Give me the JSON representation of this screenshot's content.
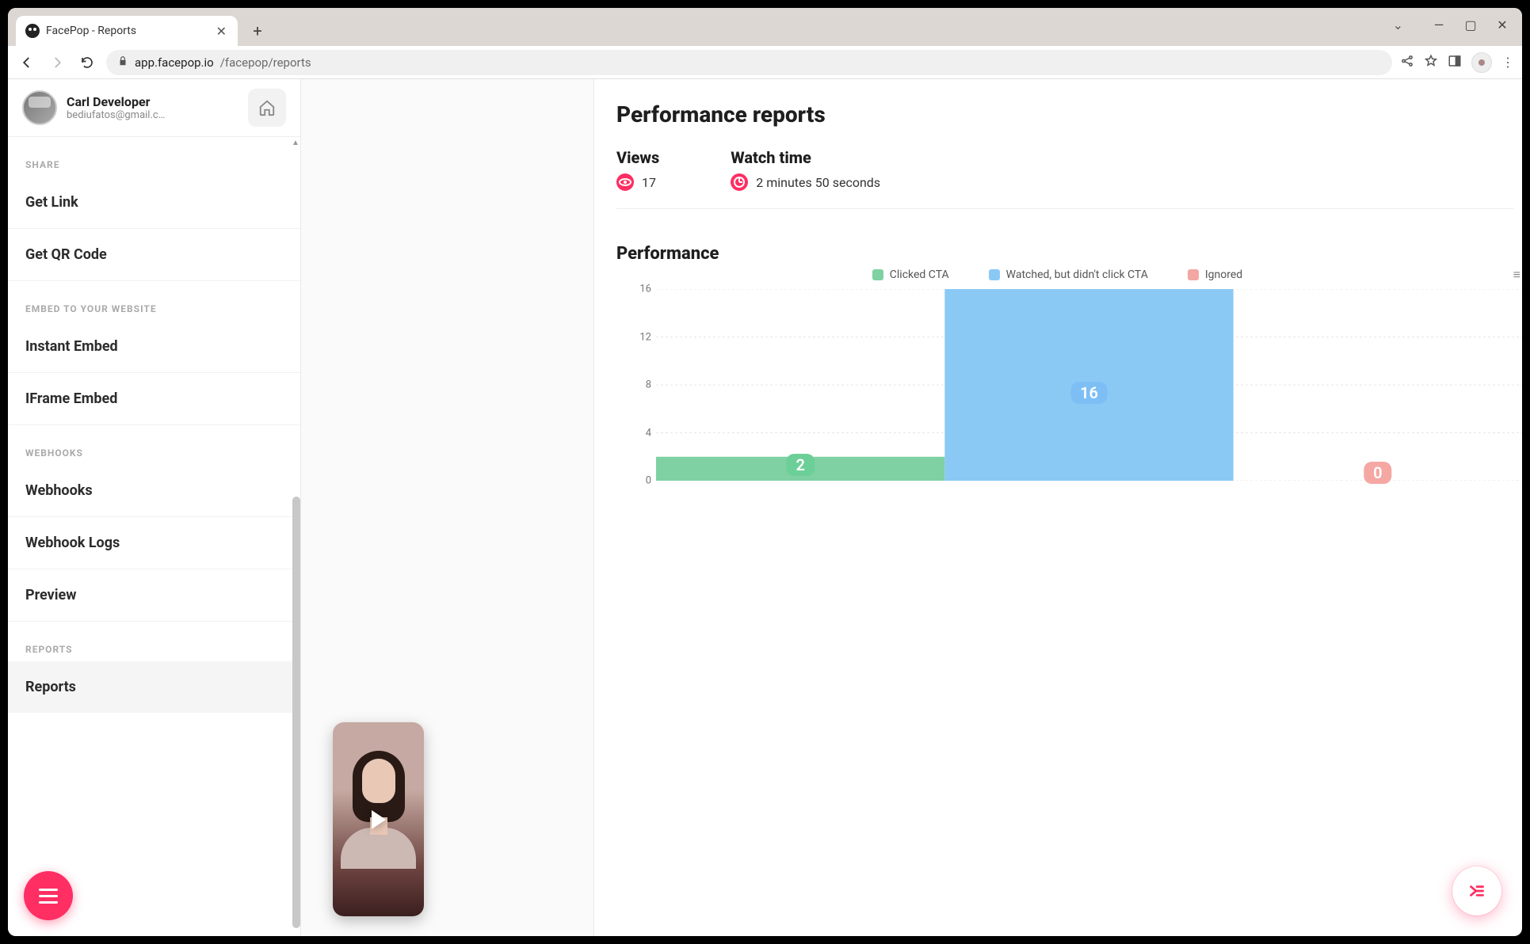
{
  "browser": {
    "tab_title": "FacePop - Reports",
    "url_domain": "app.facepop.io",
    "url_path": "/facepop/reports"
  },
  "user": {
    "name": "Carl Developer",
    "email": "bediufatos@gmail.c…"
  },
  "sidebar": {
    "sections": [
      {
        "label": "SHARE",
        "items": [
          "Get Link",
          "Get QR Code"
        ]
      },
      {
        "label": "EMBED TO YOUR WEBSITE",
        "items": [
          "Instant Embed",
          "IFrame Embed"
        ]
      },
      {
        "label": "WEBHOOKS",
        "items": [
          "Webhooks",
          "Webhook Logs",
          "Preview"
        ]
      },
      {
        "label": "REPORTS",
        "items": [
          "Reports"
        ]
      }
    ],
    "active": "Reports"
  },
  "main": {
    "title": "Performance reports",
    "views_label": "Views",
    "views_value": "17",
    "watch_label": "Watch time",
    "watch_value": "2 minutes 50 seconds",
    "perf_title": "Performance"
  },
  "legend": {
    "clicked": "Clicked CTA",
    "watched": "Watched, but didn't click CTA",
    "ignored": "Ignored"
  },
  "colors": {
    "clicked": "#7fd1a3",
    "watched": "#8bc9f5",
    "ignored": "#f2a7a3",
    "accent": "#ff2e63"
  },
  "chart_data": {
    "type": "bar",
    "categories": [
      "Clicked CTA",
      "Watched, but didn't click CTA",
      "Ignored"
    ],
    "values": [
      2,
      16,
      0
    ],
    "ylabel": "",
    "ylim": [
      0,
      16
    ],
    "yticks": [
      0,
      4,
      8,
      12,
      16
    ]
  }
}
